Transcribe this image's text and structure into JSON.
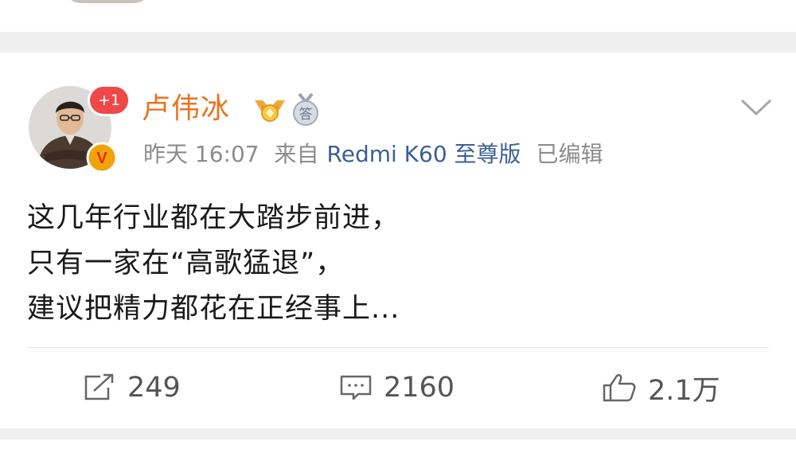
{
  "post": {
    "author": {
      "name": "卢伟冰",
      "notification_badge": "+1",
      "verified_mark": "V",
      "medal_icon": "gold-medal-icon",
      "level_icon": "answer-medal-icon",
      "level_icon_text": "答"
    },
    "meta": {
      "time": "昨天 16:07",
      "source_prefix": "来自",
      "device": "Redmi K60 至尊版",
      "edited": "已编辑"
    },
    "content_lines": [
      "这几年行业都在大踏步前进，",
      "只有一家在“高歌猛退”，",
      "建议把精力都花在正经事上..."
    ],
    "actions": {
      "repost_count": "249",
      "comment_count": "2160",
      "like_count": "2.1万"
    }
  },
  "colors": {
    "username": "#eb7320",
    "device_link": "#3b5f95",
    "meta_text": "#8c8c8c",
    "badge_red": "#f04848",
    "page_bg": "#efefef"
  }
}
